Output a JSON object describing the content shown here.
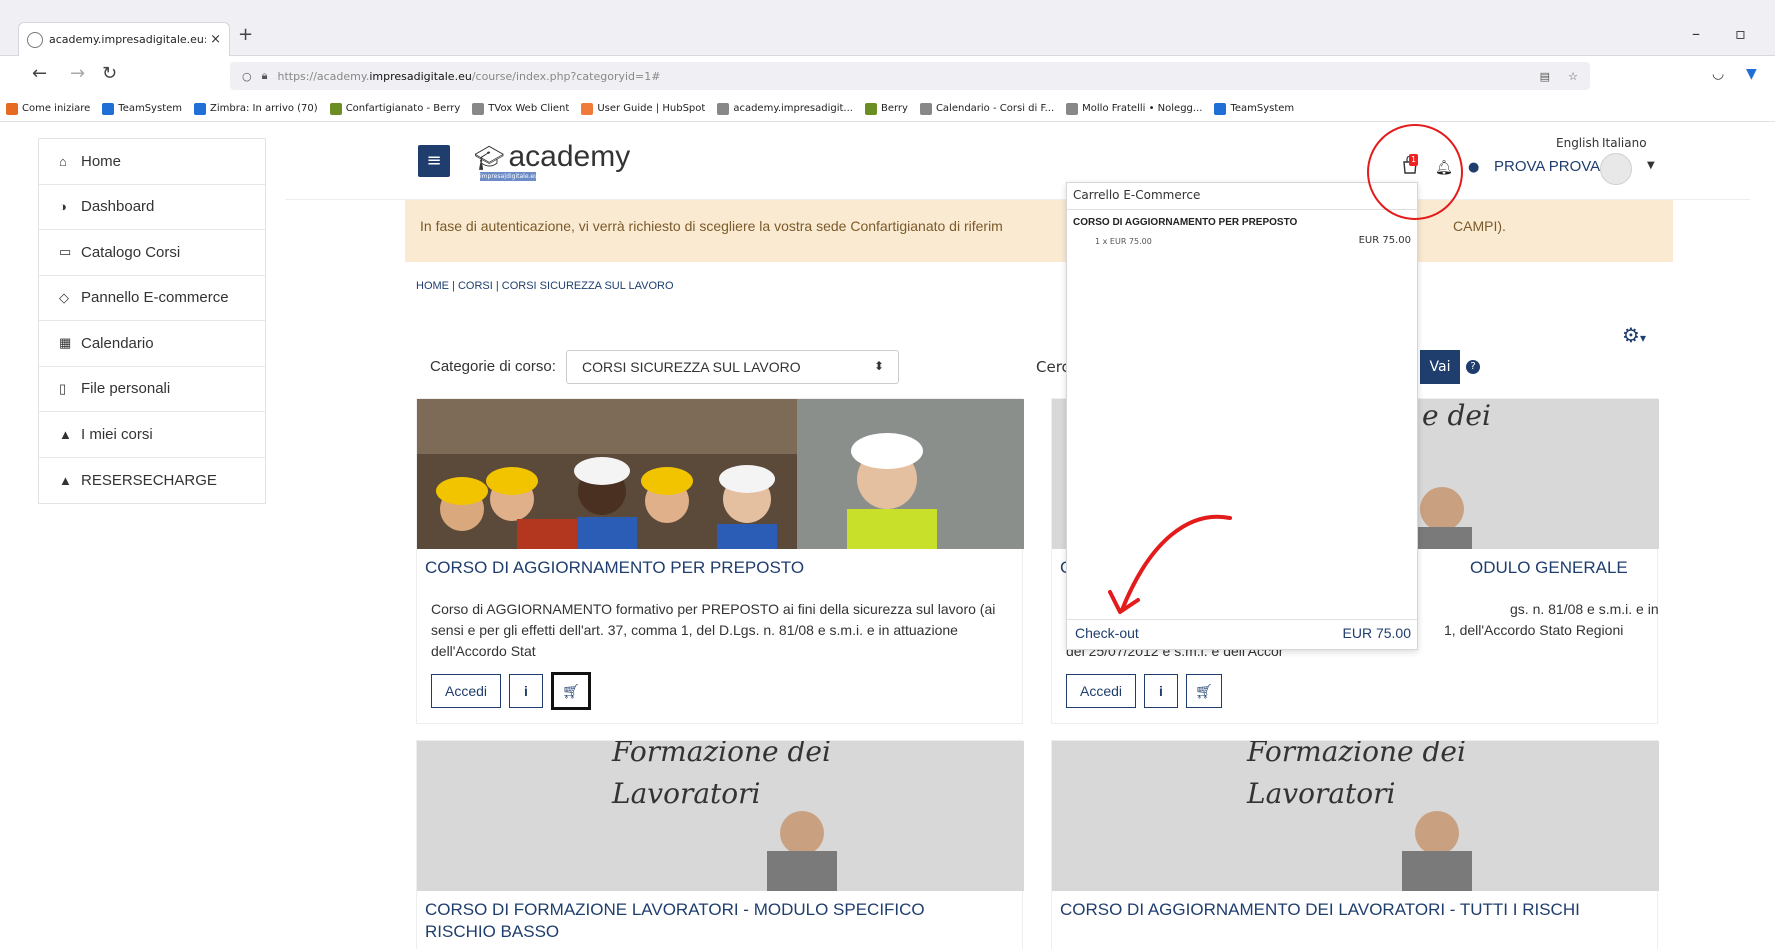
{
  "browser": {
    "tab_title": "academy.impresadigitale.eu: Tu",
    "url_prefix": "https://academy.",
    "url_host": "impresadigitale.eu",
    "url_path": "/course/index.php?categoryid=1#",
    "bookmarks": [
      {
        "label": "Come iniziare",
        "color": "#e66a1f"
      },
      {
        "label": "TeamSystem",
        "color": "#1f6fd6"
      },
      {
        "label": "Zimbra: In arrivo (70)",
        "color": "#1f6fd6"
      },
      {
        "label": "Confartigianato - Berry",
        "color": "#6b8e23"
      },
      {
        "label": "TVox Web Client",
        "color": "#888888"
      },
      {
        "label": "User Guide | HubSpot",
        "color": "#f07a3a"
      },
      {
        "label": "academy.impresadigit...",
        "color": "#888888"
      },
      {
        "label": "Berry",
        "color": "#6b8e23"
      },
      {
        "label": "Calendario - Corsi di F...",
        "color": "#888888"
      },
      {
        "label": "Mollo Fratelli • Nolegg...",
        "color": "#888888"
      },
      {
        "label": "TeamSystem",
        "color": "#1f6fd6"
      }
    ]
  },
  "sidebar": {
    "items": [
      {
        "label": "Home",
        "icon": "home-icon",
        "glyph": "⌂"
      },
      {
        "label": "Dashboard",
        "icon": "dashboard-icon",
        "glyph": "◑"
      },
      {
        "label": "Catalogo Corsi",
        "icon": "catalog-icon",
        "glyph": "▭"
      },
      {
        "label": "Pannello E-commerce",
        "icon": "ecommerce-icon",
        "glyph": "◇"
      },
      {
        "label": "Calendario",
        "icon": "calendar-icon",
        "glyph": "▦"
      },
      {
        "label": "File personali",
        "icon": "file-icon",
        "glyph": "▯"
      },
      {
        "label": "I miei corsi",
        "icon": "graduation-cap-icon",
        "glyph": "▲"
      },
      {
        "label": "RESERSECHARGE",
        "icon": "graduation-cap-icon",
        "glyph": "▲"
      }
    ]
  },
  "header": {
    "logo_text": "academy",
    "logo_sub": "impresa|digitale.eu",
    "lang_en": "English",
    "lang_it": "Italiano",
    "user_name": "PROVA PROVA",
    "cart_badge": "1"
  },
  "alert": {
    "text": "In fase di autenticazione, vi verrà richiesto di scegliere la vostra sede Confartigianato di riferim",
    "tail": "CAMPI)."
  },
  "breadcrumb": "HOME  |  CORSI  |  CORSI SICUREZZA SUL LAVORO",
  "filter": {
    "label": "Categorie di corso:",
    "selected": "CORSI SICUREZZA SUL LAVORO",
    "search_fragment": "Cerc",
    "search_button": "Vai",
    "help": "?"
  },
  "cards": [
    {
      "title": "CORSO DI AGGIORNAMENTO PER PREPOSTO",
      "description": "Corso di AGGIORNAMENTO formativo per  PREPOSTO ai fini della sicurezza sul lavoro (ai sensi e per gli effetti dell'art. 37, comma 1, del D.Lgs. n. 81/08 e s.m.i. e in attuazione dell'Accordo Stat",
      "btn_access": "Accedi",
      "btn_info": "i"
    },
    {
      "title_start": "C",
      "title_end": "ODULO GENERALE",
      "desc_frag1": "gs. n. 81/08 e s.m.i. e in",
      "desc_frag2": "1, dell'Accordo Stato Regioni",
      "desc_line3": "del 25/07/2012 e s.m.i. e dell'Accor",
      "board_text": "e dei",
      "btn_access": "Accedi",
      "btn_info": "i"
    },
    {
      "title": "CORSO DI FORMAZIONE LAVORATORI - MODULO SPECIFICO RISCHIO BASSO",
      "board_line1": "Formazione dei",
      "board_line2": "Lavoratori"
    },
    {
      "title": "CORSO DI AGGIORNAMENTO DEI LAVORATORI - TUTTI I RISCHI",
      "board_line1": "Formazione dei",
      "board_line2": "Lavoratori"
    }
  ],
  "cart": {
    "header": "Carrello E-Commerce",
    "item_title": "CORSO DI AGGIORNAMENTO PER PREPOSTO",
    "item_qty": "1 x EUR 75.00",
    "item_price": "EUR 75.00",
    "checkout": "Check-out",
    "total": "EUR 75.00"
  },
  "colors": {
    "brand": "#1f3e6e",
    "alert_bg": "#fbead2",
    "annotation": "#e41b1b"
  }
}
